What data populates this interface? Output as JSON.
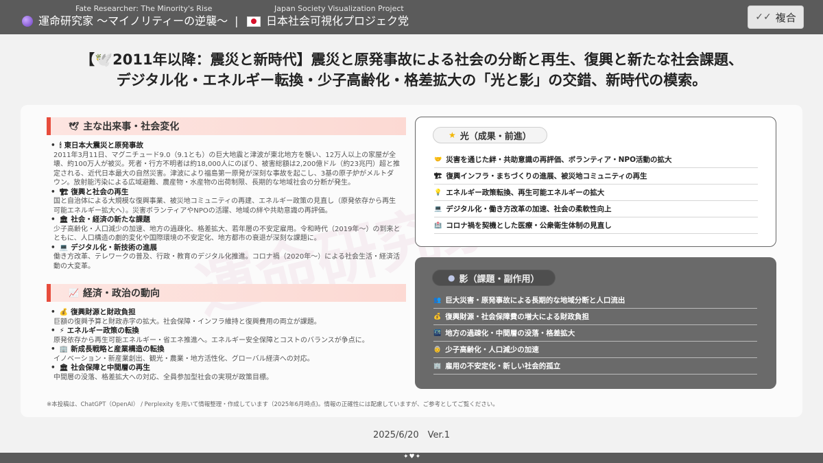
{
  "header": {
    "left_small": "Fate Researcher: The Minority's Rise",
    "left_main": "運命研究家 〜マイノリティーの逆襲〜",
    "separator": "|",
    "right_small": "Japan Society Visualization Project",
    "right_main": "日本社会可視化プロジェク党",
    "copy_label": "複合"
  },
  "headline": {
    "line1": "【🕊️2011年以降：震災と新時代】震災と原発事故による社会の分断と再生、復興と新たな社会課題、",
    "line2": "デジタル化・エネルギー転換・少子高齢化・格差拡大の「光と影」の交錯、新時代の模索。"
  },
  "events": {
    "heading": "主な出来事・社会変化",
    "items": [
      {
        "title": "東日本大震災と原発事故",
        "desc": "2011年3月11日、マグニチュード9.0（9.1とも）の巨大地震と津波が東北地方を襲い、12万人以上の家屋が全壊、約100万人が被災。死者・行方不明者は約18,000人にのぼり、被害総額は2,200億ドル（約23兆円）超と推定される、近代日本最大の自然災害。津波により福島第一原発が深刻な事故を起こし、3基の原子炉がメルトダウン。放射能汚染による広域避難、農産物・水産物の出荷制限、長期的な地域社会の分断が発生。"
      },
      {
        "title": "復興と社会の再生",
        "desc": "国と自治体による大規模な復興事業、被災地コミュニティの再建、エネルギー政策の見直し（原発依存から再生可能エネルギー拡大へ）。災害ボランティアやNPOの活躍、地域の絆や共助意識の再評価。"
      },
      {
        "title": "社会・経済の新たな課題",
        "desc": "少子高齢化・人口減少の加速、地方の過疎化、格差拡大、若年層の不安定雇用。令和時代（2019年〜）の到来とともに、人口構造の劇的変化や国際環境の不安定化、地方都市の衰退が深刻な課題に。"
      },
      {
        "title": "デジタル化・新技術の進展",
        "desc": "働き方改革、テレワークの普及、行政・教育のデジタル化推進。コロナ禍（2020年〜）による社会生活・経済活動の大変革。"
      }
    ]
  },
  "economy": {
    "heading": "経済・政治の動向",
    "items": [
      {
        "title": "復興財源と財政負担",
        "desc": "巨額の復興予算と財政赤字の拡大。社会保障・インフラ維持と復興費用の両立が課題。"
      },
      {
        "title": "エネルギー政策の転換",
        "desc": "原発依存から再生可能エネルギー・省エネ推進へ。エネルギー安全保障とコストのバランスが争点に。"
      },
      {
        "title": "新成長戦略と産業構造の転換",
        "desc": "イノベーション・新産業創出、観光・農業・地方活性化、グローバル経済への対応。"
      },
      {
        "title": "社会保障と中間層の再生",
        "desc": "中間層の没落、格差拡大への対応、全員参加型社会の実現が政策目標。"
      }
    ]
  },
  "light": {
    "heading": "光（成果・前進）",
    "items": [
      "災害を通じた絆・共助意識の再評価、ボランティア・NPO活動の拡大",
      "復興インフラ・まちづくりの進展、被災地コミュニティの再生",
      "エネルギー政策転換、再生可能エネルギーの拡大",
      "デジタル化・働き方改革の加速、社会の柔軟性向上",
      "コロナ禍を契機とした医療・公衆衛生体制の見直し"
    ]
  },
  "shadow": {
    "heading": "影（課題・副作用）",
    "items": [
      "巨大災害・原発事故による長期的な地域分断と人口流出",
      "復興財源・社会保障費の増大による財政負担",
      "地方の過疎化・中間層の没落・格差拡大",
      "少子高齢化・人口減少の加速",
      "雇用の不安定化・新しい社会的孤立"
    ]
  },
  "footnote": "※本投稿は、ChatGPT（OpenAI） / Perplexity を用いて情報整理・作成しています（2025年6月時点)。情報の正確性には配慮していますが、ご参考としてご覧ください。",
  "version": "2025/6/20　Ver.1"
}
